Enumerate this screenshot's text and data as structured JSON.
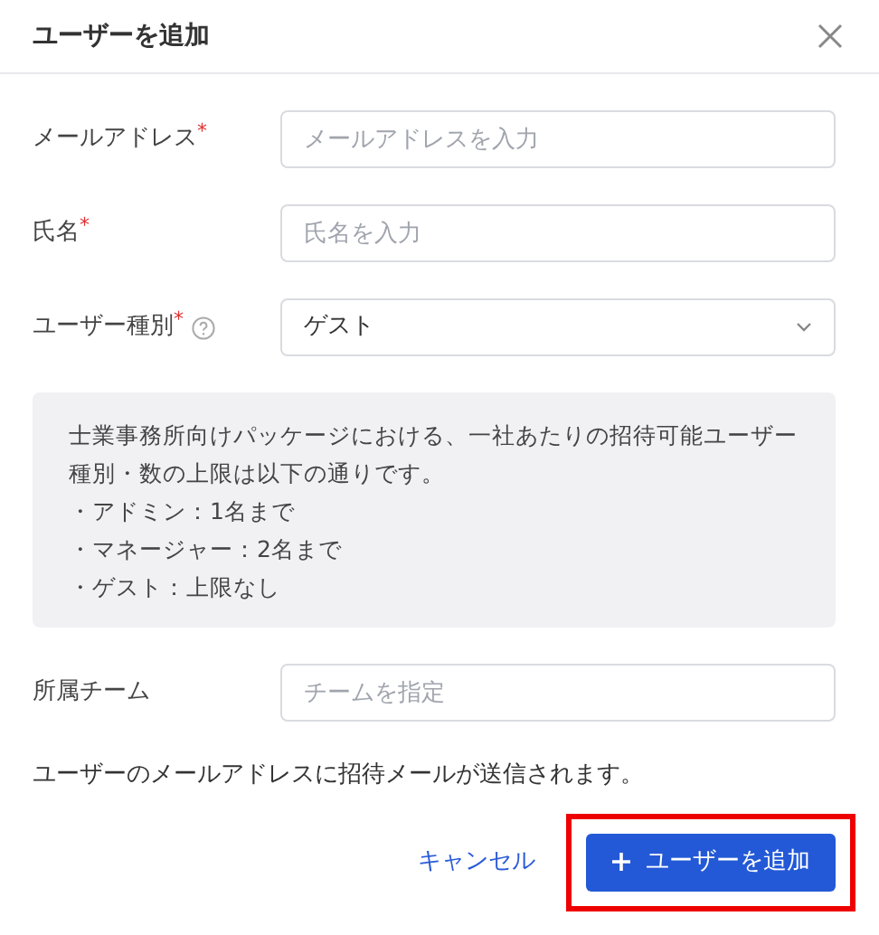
{
  "dialog": {
    "title": "ユーザーを追加"
  },
  "required_mark": "*",
  "fields": [
    {
      "kind": "input",
      "label": "メールアドレス",
      "required": true,
      "help": false,
      "placeholder": "メールアドレスを入力"
    },
    {
      "kind": "input",
      "label": "氏名",
      "required": true,
      "help": false,
      "placeholder": "氏名を入力"
    },
    {
      "kind": "select",
      "label": "ユーザー種別",
      "required": true,
      "help": true,
      "value": "ゲスト"
    }
  ],
  "info": {
    "text": "士業事務所向けパッケージにおける、一社あたりの招待可能ユーザー種別・数の上限は以下の通りです。",
    "lines": [
      "・アドミン：1名まで",
      "・マネージャー：2名まで",
      "・ゲスト：上限なし"
    ]
  },
  "team_field": {
    "kind": "input",
    "label": "所属チーム",
    "required": false,
    "help": false,
    "placeholder": "チームを指定"
  },
  "note": "ユーザーのメールアドレスに招待メールが送信されます。",
  "buttons": [
    {
      "kind": "link",
      "label": "キャンセル",
      "highlighted": false
    },
    {
      "kind": "primary",
      "label": "ユーザーを追加",
      "highlighted": true
    }
  ]
}
